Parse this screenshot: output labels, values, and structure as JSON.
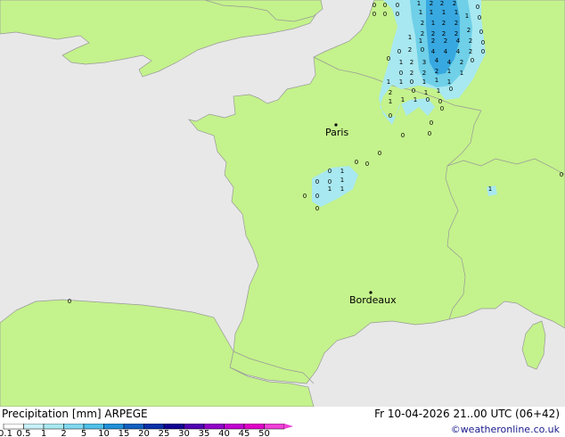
{
  "map": {
    "colors": {
      "sea": "#e8e8e8",
      "land": "#c4f28c",
      "coast": "#999999",
      "precip_light": "#a8e8f0",
      "precip_med": "#6fd0e8",
      "precip_strong": "#38a8e0"
    },
    "cities": [
      {
        "name": "Paris"
      },
      {
        "name": "Bordeaux"
      }
    ]
  },
  "footer": {
    "title": "Precipitation [mm]  ARPEGE",
    "datetime": "Fr 10-04-2026 21..00 UTC (06+42)",
    "credit": "©weatheronline.co.uk"
  },
  "legend": {
    "labels": [
      "0.1",
      "0.5",
      "1",
      "2",
      "5",
      "10",
      "15",
      "20",
      "25",
      "30",
      "35",
      "40",
      "45",
      "50"
    ],
    "colors": [
      "#ffffff",
      "#c8f0f8",
      "#a8e8f0",
      "#80d8f0",
      "#50c0e8",
      "#2090d8",
      "#1060c0",
      "#0830a8",
      "#100090",
      "#5000b0",
      "#9000c8",
      "#c000d0",
      "#e000c8",
      "#f040d8"
    ]
  }
}
